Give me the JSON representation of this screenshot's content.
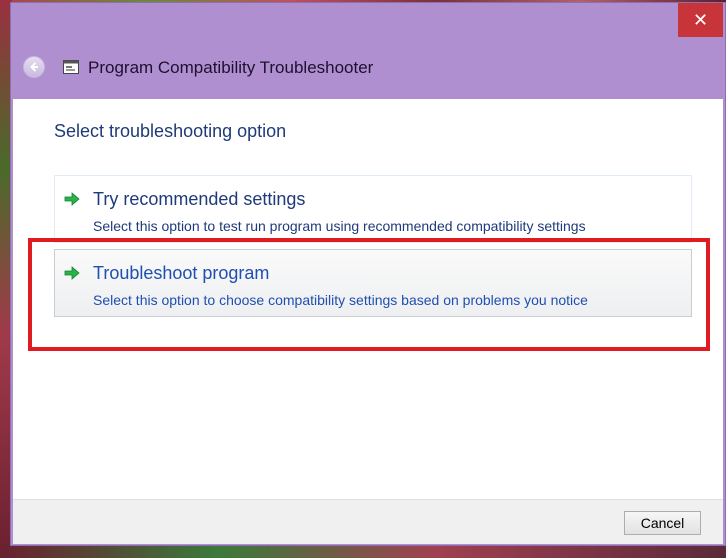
{
  "window": {
    "title": "Program Compatibility Troubleshooter",
    "close_glyph": "✕"
  },
  "content": {
    "heading": "Select troubleshooting option",
    "options": [
      {
        "title": "Try recommended settings",
        "description": "Select this option to test run program using recommended compatibility settings"
      },
      {
        "title": "Troubleshoot program",
        "description": "Select this option to choose compatibility settings based on problems you notice"
      }
    ]
  },
  "footer": {
    "cancel_label": "Cancel"
  },
  "icons": {
    "back": "back-arrow-icon",
    "app": "troubleshooter-app-icon",
    "option_arrow": "green-arrow-icon",
    "close": "close-icon"
  },
  "colors": {
    "title_bar": "#af8fd0",
    "close_button": "#c7343a",
    "link_blue": "#1f4fb0",
    "heading_blue": "#1f3a7a",
    "highlight_red": "#e11b22"
  }
}
